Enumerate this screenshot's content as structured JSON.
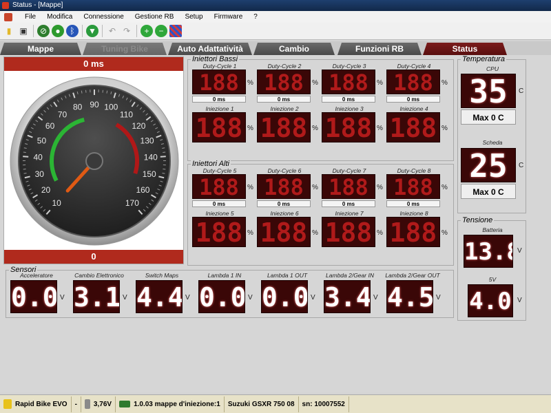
{
  "window": {
    "title": "Status - [Mappe]"
  },
  "menu": {
    "items": [
      "File",
      "Modifica",
      "Connessione",
      "Gestione RB",
      "Setup",
      "Firmware",
      "?"
    ]
  },
  "toolbar": {
    "icons": [
      "open-folder-icon",
      "save-icon",
      "disconnect-icon",
      "connect-icon",
      "bluetooth-icon",
      "download-icon",
      "undo-icon",
      "redo-icon",
      "zoom-in-icon",
      "zoom-out-icon",
      "grid-icon"
    ]
  },
  "tabs": [
    {
      "label": "Mappe",
      "state": "normal"
    },
    {
      "label": "Tuning Bike",
      "state": "disabled"
    },
    {
      "label": "Auto Adattatività",
      "state": "normal"
    },
    {
      "label": "Cambio",
      "state": "normal"
    },
    {
      "label": "Funzioni RB",
      "state": "normal"
    },
    {
      "label": "Status",
      "state": "active"
    }
  ],
  "rpm": {
    "top_value": "0 ms",
    "bottom_value": "0",
    "gauge_ticks": [
      "10",
      "20",
      "30",
      "40",
      "50",
      "60",
      "70",
      "80",
      "90",
      "100",
      "110",
      "120",
      "130",
      "140",
      "150",
      "160",
      "170"
    ],
    "needle_value": 10,
    "colors": {
      "needle": "#e05a14",
      "green_arc": "#2bb534",
      "red_arc": "#b01818",
      "bar": "#b02a1d"
    }
  },
  "injectors_low": {
    "title": "Iniettori Bassi",
    "duty": [
      {
        "label": "Duty-Cycle 1",
        "display": "188",
        "unit": "%",
        "ms": "0 ms"
      },
      {
        "label": "Duty-Cycle 2",
        "display": "188",
        "unit": "%",
        "ms": "0 ms"
      },
      {
        "label": "Duty-Cycle 3",
        "display": "188",
        "unit": "%",
        "ms": "0 ms"
      },
      {
        "label": "Duty-Cycle 4",
        "display": "188",
        "unit": "%",
        "ms": "0 ms"
      }
    ],
    "injection": [
      {
        "label": "Iniezione 1",
        "display": "188",
        "unit": "%"
      },
      {
        "label": "Iniezione 2",
        "display": "188",
        "unit": "%"
      },
      {
        "label": "Iniezione 3",
        "display": "188",
        "unit": "%"
      },
      {
        "label": "Iniezione 4",
        "display": "188",
        "unit": "%"
      }
    ]
  },
  "injectors_high": {
    "title": "Iniettori Alti",
    "duty": [
      {
        "label": "Duty-Cycle 5",
        "display": "188",
        "unit": "%",
        "ms": "0 ms"
      },
      {
        "label": "Duty-Cycle 6",
        "display": "188",
        "unit": "%",
        "ms": "0 ms"
      },
      {
        "label": "Duty-Cycle 7",
        "display": "188",
        "unit": "%",
        "ms": "0 ms"
      },
      {
        "label": "Duty-Cycle 8",
        "display": "188",
        "unit": "%",
        "ms": "0 ms"
      }
    ],
    "injection": [
      {
        "label": "Iniezione 5",
        "display": "188",
        "unit": "%"
      },
      {
        "label": "Iniezione 6",
        "display": "188",
        "unit": "%"
      },
      {
        "label": "Iniezione 7",
        "display": "188",
        "unit": "%"
      },
      {
        "label": "Iniezione 8",
        "display": "188",
        "unit": "%"
      }
    ]
  },
  "temperature": {
    "title": "Temperatura",
    "cpu": {
      "label": "CPU",
      "display": "35",
      "unit": "C",
      "max": "Max 0 C"
    },
    "board": {
      "label": "Scheda",
      "display": "25",
      "unit": "C",
      "max": "Max 0 C"
    }
  },
  "voltage": {
    "title": "Tensione",
    "battery": {
      "label": "Batteria",
      "display": "13.8",
      "unit": "V"
    },
    "five_v": {
      "label": "5V",
      "display": "4.0",
      "unit": "V"
    }
  },
  "sensors": {
    "title": "Sensori",
    "items": [
      {
        "label": "Acceleratore",
        "display": "0.0",
        "unit": "V"
      },
      {
        "label": "Cambio Elettronico",
        "display": "3.1",
        "unit": "V"
      },
      {
        "label": "Switch Maps",
        "display": "4.4",
        "unit": "V"
      },
      {
        "label": "Lambda 1 IN",
        "display": "0.0",
        "unit": "V"
      },
      {
        "label": "Lambda 1 OUT",
        "display": "0.0",
        "unit": "V"
      },
      {
        "label": "Lambda 2/Gear IN",
        "display": "3.4",
        "unit": "V"
      },
      {
        "label": "Lambda 2/Gear OUT",
        "display": "4.5",
        "unit": "V"
      }
    ]
  },
  "statusbar": {
    "device": "Rapid Bike EVO",
    "dash": "-",
    "voltage": "3,76V",
    "maps": "1.0.03 mappe d'iniezione:1",
    "bike": "Suzuki GSXR 750 08",
    "serial": "sn: 10007552"
  }
}
